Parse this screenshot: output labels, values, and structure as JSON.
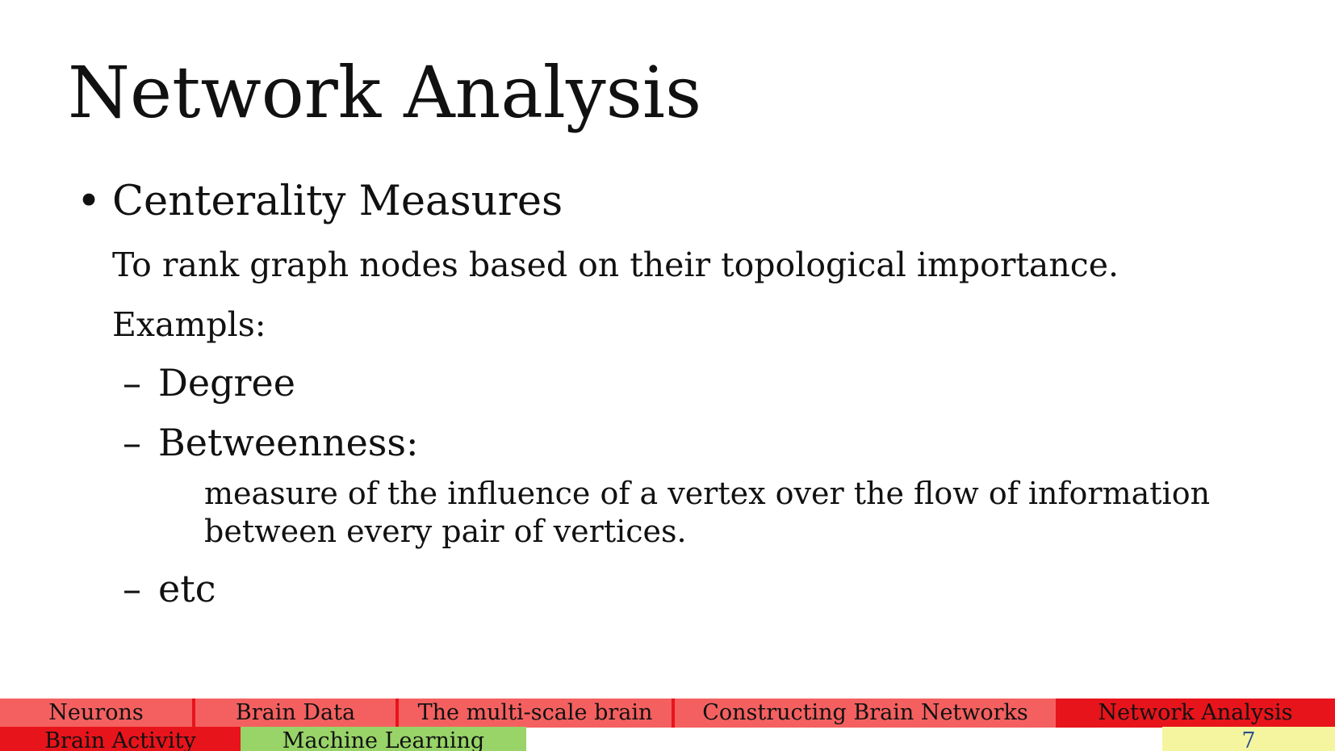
{
  "slide": {
    "title": "Network Analysis",
    "bullet_symbol": "•",
    "bullet": "Centerality Measures",
    "description": "To rank graph nodes based on their topological importance.",
    "examples_label": "Exampls:",
    "dash_symbol": "–",
    "items": [
      "Degree",
      "Betweenness:",
      "etc"
    ],
    "betweenness_description": "measure of the influence of a vertex over the flow of information between every pair of vertices."
  },
  "nav": {
    "row1": [
      "Neurons",
      "Brain Data",
      "The multi-scale brain",
      "Constructing Brain Networks",
      "Network Analysis"
    ],
    "row2": [
      "Brain Activity",
      "Machine Learning"
    ],
    "page_number": "7"
  },
  "colors": {
    "section_inactive": "#f46060",
    "section_active": "#e8141b",
    "brain_activity": "#e8141b",
    "machine_learning": "#98d468",
    "page_number_bg": "#f5f5a0",
    "page_number_text": "#2f4f8f"
  }
}
